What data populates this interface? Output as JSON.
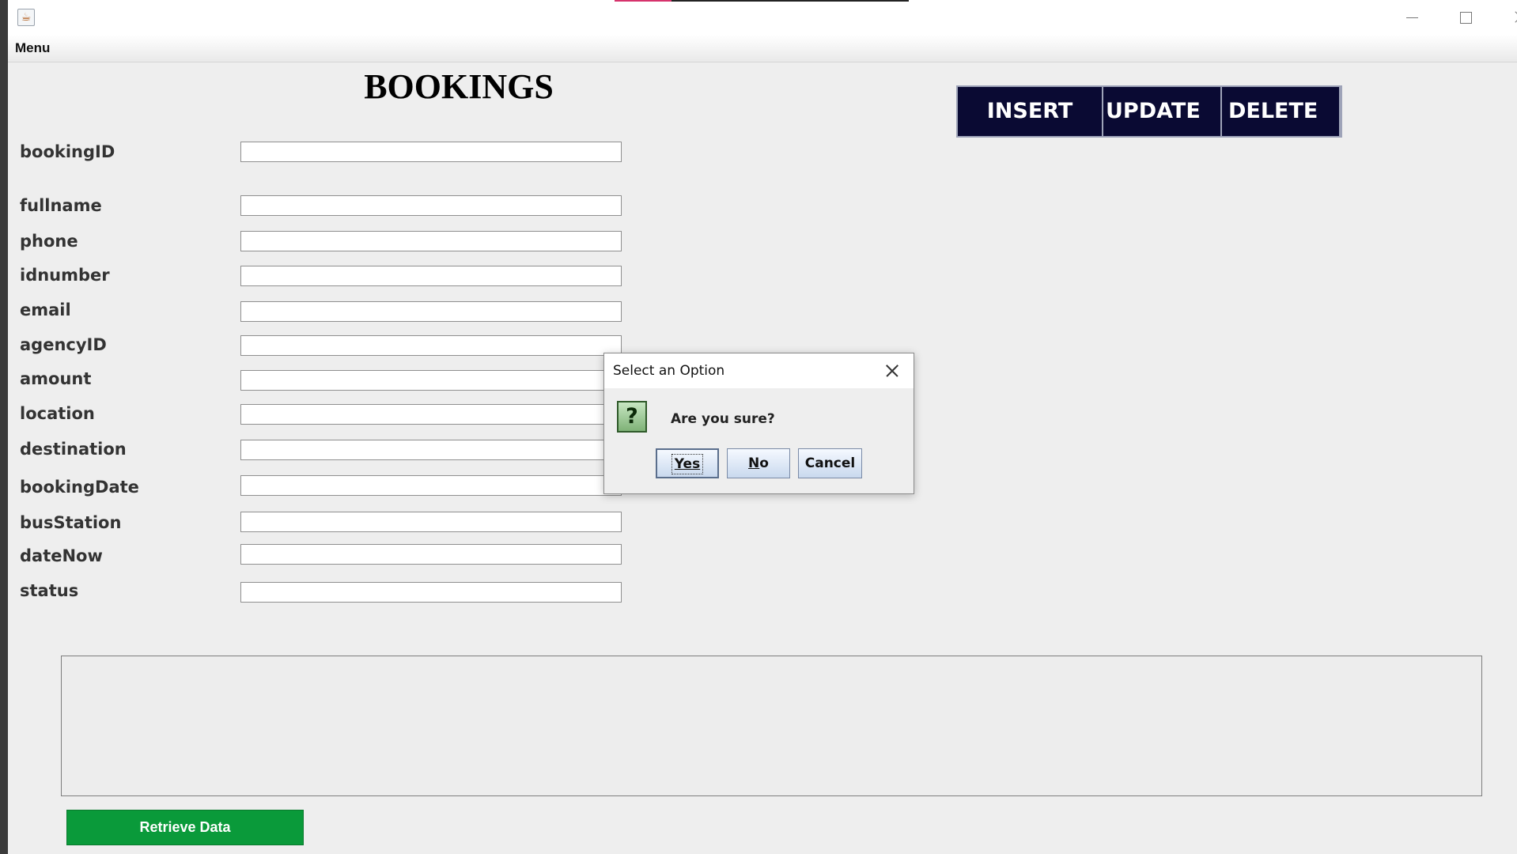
{
  "window": {
    "menu_label": "Menu"
  },
  "page": {
    "title": "BOOKINGS"
  },
  "actions": {
    "insert": "INSERT",
    "update": "UPDATE",
    "delete": "DELETE"
  },
  "form": {
    "fields": [
      {
        "label": "bookingID",
        "value": ""
      },
      {
        "label": "fullname",
        "value": ""
      },
      {
        "label": "phone",
        "value": ""
      },
      {
        "label": "idnumber",
        "value": ""
      },
      {
        "label": "email",
        "value": ""
      },
      {
        "label": "agencyID",
        "value": ""
      },
      {
        "label": "amount",
        "value": ""
      },
      {
        "label": "location",
        "value": ""
      },
      {
        "label": "destination",
        "value": ""
      },
      {
        "label": "bookingDate",
        "value": ""
      },
      {
        "label": "busStation",
        "value": ""
      },
      {
        "label": "dateNow",
        "value": ""
      },
      {
        "label": "status",
        "value": ""
      }
    ]
  },
  "retrieve_label": "Retrieve Data",
  "dialog": {
    "title": "Select an Option",
    "message": "Are you sure?",
    "icon": "question-icon",
    "buttons": {
      "yes_mnemonic": "Y",
      "yes_rest": "es",
      "no_mnemonic": "N",
      "no_rest": "o",
      "cancel": "Cancel"
    }
  },
  "colors": {
    "action_bar_bg": "#0a0a33",
    "retrieve_bg": "#0a9a3a",
    "window_bg": "#eeeeee"
  }
}
